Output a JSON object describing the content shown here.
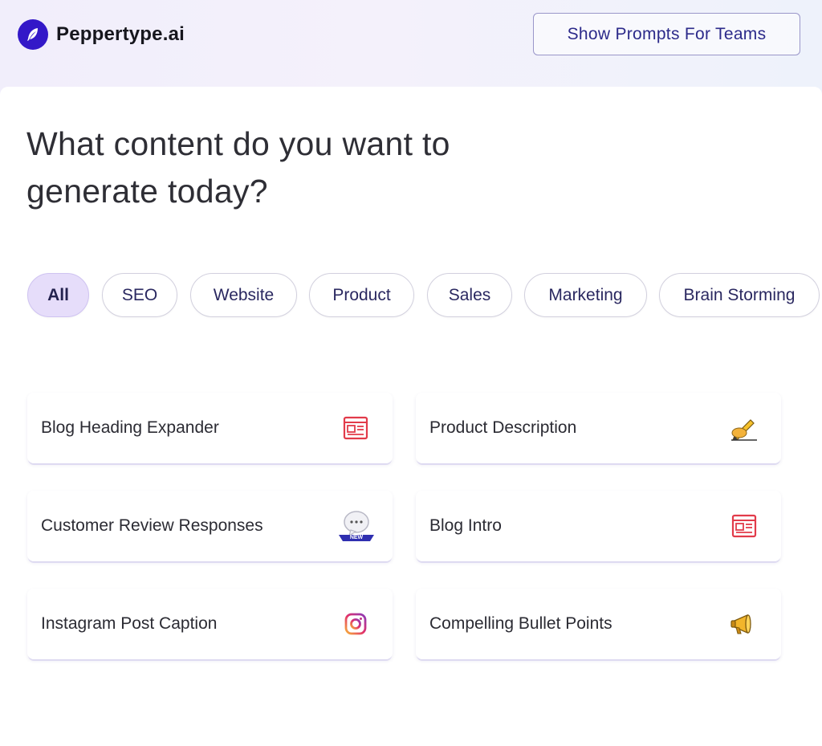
{
  "brand": {
    "name": "Peppertype.ai",
    "logo_icon": "feather-pen-icon",
    "color": "#3318c8"
  },
  "header": {
    "teams_button_label": "Show Prompts For Teams"
  },
  "main": {
    "heading_line1": "What content do you want to",
    "heading_line2": "generate today?"
  },
  "filters": {
    "selected": "All",
    "items": [
      {
        "label": "All"
      },
      {
        "label": "SEO"
      },
      {
        "label": "Website"
      },
      {
        "label": "Product"
      },
      {
        "label": "Sales"
      },
      {
        "label": "Marketing"
      },
      {
        "label": "Brain Storming"
      }
    ]
  },
  "templates": [
    {
      "label": "Blog Heading Expander",
      "icon": "newspaper-icon"
    },
    {
      "label": "Product Description",
      "icon": "writing-hand-icon"
    },
    {
      "label": "Customer Review Responses",
      "icon": "speech-bubble-icon",
      "badge": "NEW"
    },
    {
      "label": "Blog Intro",
      "icon": "newspaper-icon"
    },
    {
      "label": "Instagram Post Caption",
      "icon": "instagram-icon"
    },
    {
      "label": "Compelling Bullet Points",
      "icon": "megaphone-icon"
    }
  ],
  "colors": {
    "accent": "#e6ddfa",
    "button_text": "#2c2a8a",
    "newspaper": "#e23b4a",
    "badge": "#2f2fb0"
  }
}
